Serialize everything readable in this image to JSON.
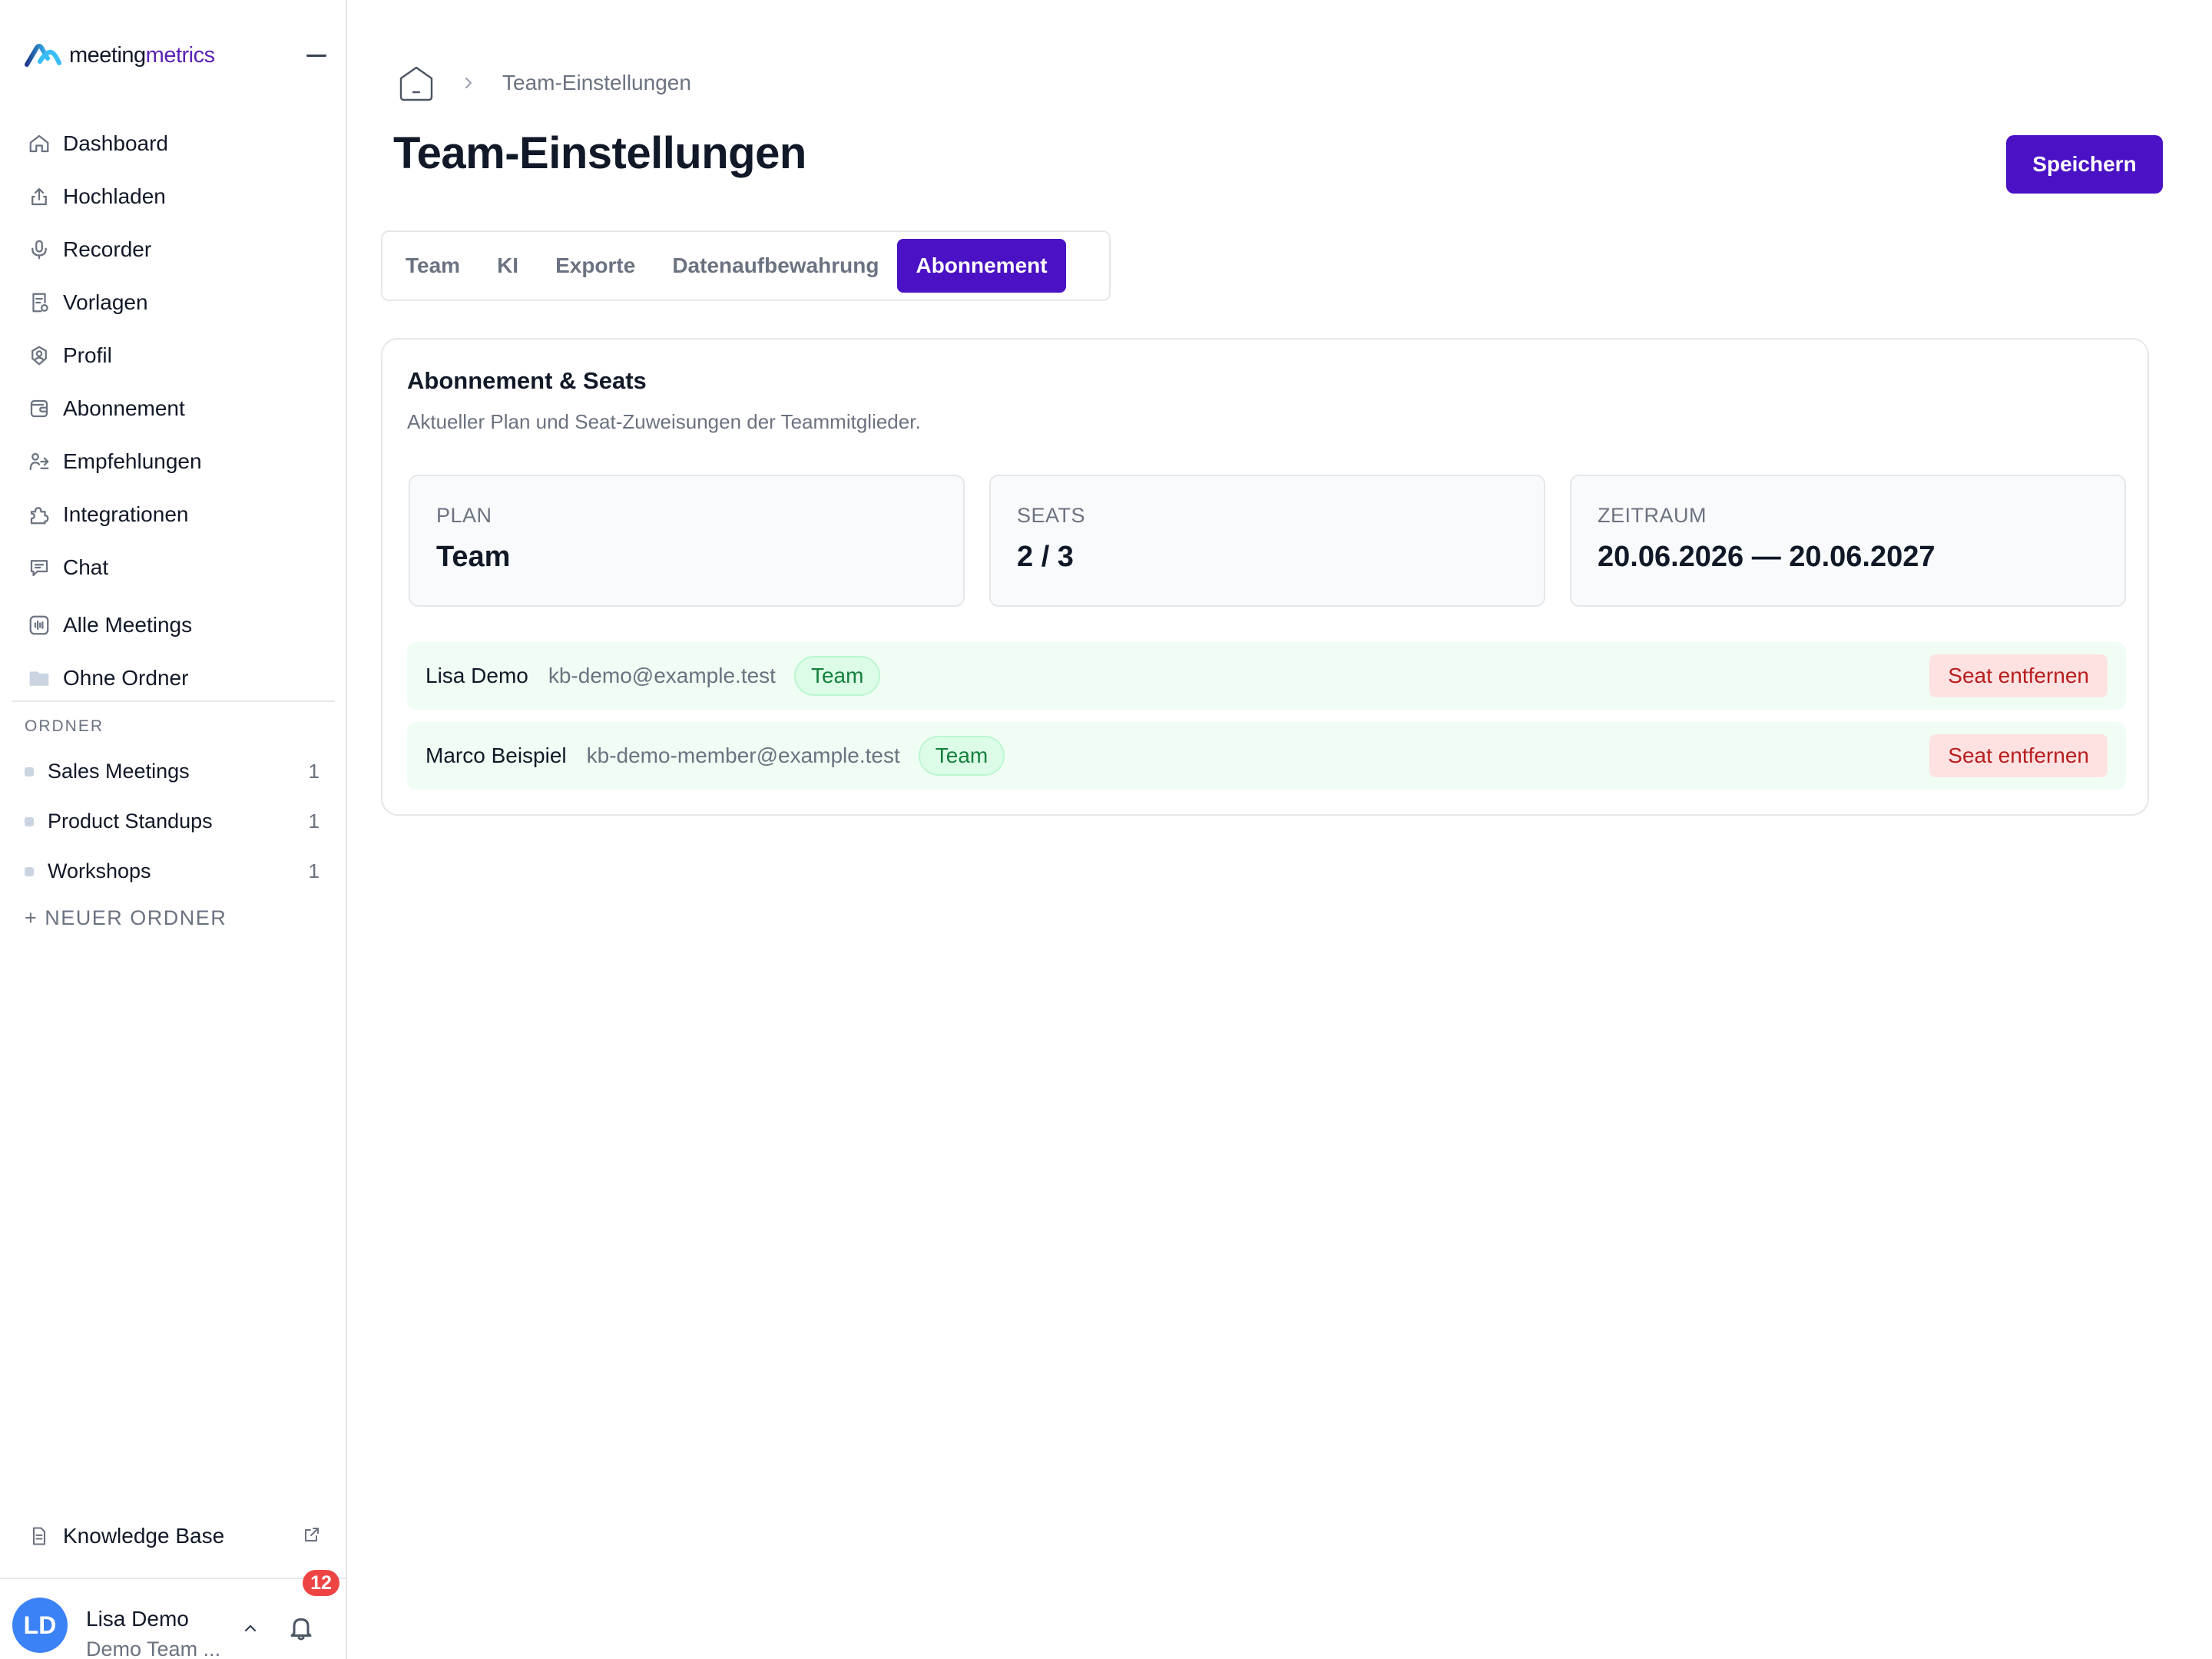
{
  "brand": {
    "name_part1": "meeting",
    "name_part2": "metrics",
    "accent_color": "#4a12c4"
  },
  "sidebar": {
    "nav": [
      {
        "label": "Dashboard",
        "icon": "home-icon"
      },
      {
        "label": "Hochladen",
        "icon": "upload-icon"
      },
      {
        "label": "Recorder",
        "icon": "microphone-icon"
      },
      {
        "label": "Vorlagen",
        "icon": "template-icon"
      },
      {
        "label": "Profil",
        "icon": "profile-icon"
      },
      {
        "label": "Abonnement",
        "icon": "wallet-icon"
      },
      {
        "label": "Empfehlungen",
        "icon": "referral-icon"
      },
      {
        "label": "Integrationen",
        "icon": "puzzle-icon"
      },
      {
        "label": "Chat",
        "icon": "chat-icon"
      },
      {
        "label": "Alle Meetings",
        "icon": "waveform-icon"
      },
      {
        "label": "Ohne Ordner",
        "icon": "folder-icon"
      }
    ],
    "folders_label": "ORDNER",
    "folders": [
      {
        "label": "Sales Meetings",
        "count": "1"
      },
      {
        "label": "Product Standups",
        "count": "1"
      },
      {
        "label": "Workshops",
        "count": "1"
      }
    ],
    "new_folder": "+ NEUER ORDNER",
    "knowledge_base": "Knowledge Base",
    "user": {
      "initials": "LD",
      "name": "Lisa Demo",
      "team": "Demo Team ...",
      "notifications": "12"
    }
  },
  "breadcrumb": {
    "current": "Team-Einstellungen"
  },
  "page": {
    "title": "Team-Einstellungen",
    "save_label": "Speichern"
  },
  "tabs": [
    {
      "label": "Team",
      "active": false
    },
    {
      "label": "KI",
      "active": false
    },
    {
      "label": "Exporte",
      "active": false
    },
    {
      "label": "Datenaufbewahrung",
      "active": false
    },
    {
      "label": "Abonnement",
      "active": true
    }
  ],
  "subscription": {
    "title": "Abonnement & Seats",
    "subtitle": "Aktueller Plan und Seat-Zuweisungen der Teammitglieder.",
    "stats": [
      {
        "label": "PLAN",
        "value": "Team"
      },
      {
        "label": "SEATS",
        "value": "2 / 3"
      },
      {
        "label": "ZEITRAUM",
        "value": "20.06.2026 — 20.06.2027"
      }
    ],
    "members": [
      {
        "name": "Lisa Demo",
        "email": "kb-demo@example.test",
        "badge": "Team",
        "action": "Seat entfernen"
      },
      {
        "name": "Marco Beispiel",
        "email": "kb-demo-member@example.test",
        "badge": "Team",
        "action": "Seat entfernen"
      }
    ]
  }
}
